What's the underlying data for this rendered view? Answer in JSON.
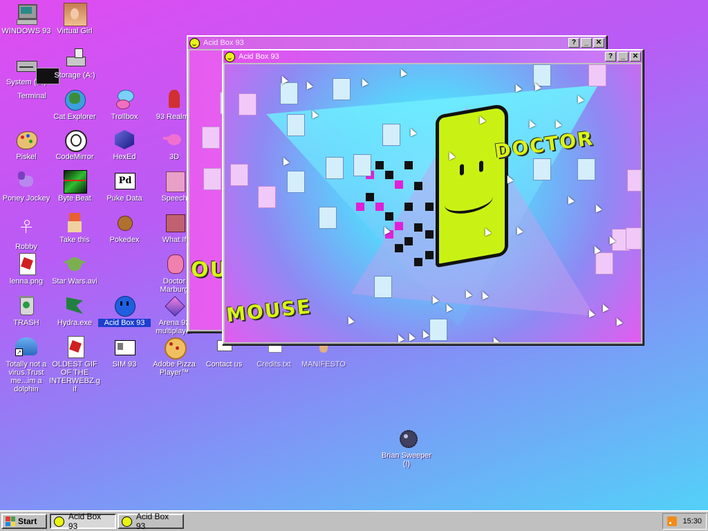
{
  "desktop": {
    "icons": [
      {
        "label": "WINDOWS 93",
        "icon": "computer-icon",
        "color": "#8c8c8c"
      },
      {
        "label": "Virtual Girl",
        "icon": "face-portrait-icon",
        "color": "#e0a070"
      },
      {
        "label": "System (C:)",
        "icon": "drive-icon",
        "color": "#a0a0a0"
      },
      {
        "label": "Storage (A:)",
        "icon": "floppy-drive-icon",
        "color": "#b0b0b0"
      },
      {
        "label": "Terminal",
        "icon": "terminal-icon",
        "color": "#111111"
      },
      {
        "label": "Cat Explorer",
        "icon": "globe-cat-icon",
        "color": "#3c8c3c"
      },
      {
        "label": "Trollbox",
        "icon": "chat-bubble-icon",
        "color": "#4ab0e8"
      },
      {
        "label": "93 Realms",
        "icon": "knight-icon",
        "color": "#d03030"
      },
      {
        "label": "Piskel",
        "icon": "palette-icon",
        "color": "#e0b050"
      },
      {
        "label": "CodeMirror",
        "icon": "codemirror-icon",
        "color": "#ffffff"
      },
      {
        "label": "HexEd",
        "icon": "hexagon-icon",
        "color": "#3030a0"
      },
      {
        "label": "3D",
        "icon": "teapot-icon",
        "color": "#f070d0"
      },
      {
        "label": "Poney Jockey",
        "icon": "pony-icon",
        "color": "#a070e0"
      },
      {
        "label": "Byte Beat",
        "icon": "byte-beat-icon",
        "color": "#104010"
      },
      {
        "label": "Puke Data",
        "icon": "pd-icon",
        "color": "#ffffff"
      },
      {
        "label": "Speech",
        "icon": "speech-face-icon",
        "color": "#e090c0"
      },
      {
        "label": "Robby",
        "icon": "stick-figure-icon",
        "color": "#ffffff"
      },
      {
        "label": "Take this",
        "icon": "pixel-character-icon",
        "color": "#e86030"
      },
      {
        "label": "Pokedex",
        "icon": "pokedex-icon",
        "color": "#b07030"
      },
      {
        "label": "What If",
        "icon": "book-icon",
        "color": "#c06070"
      },
      {
        "label": "lenna.png",
        "icon": "image-file-icon",
        "color": "#d02020"
      },
      {
        "label": "Star Wars.avi",
        "icon": "yoda-icon",
        "color": "#60a040"
      },
      {
        "label": "Doctor Marburg",
        "icon": "doctor-icon",
        "color": "#f070a0"
      },
      {
        "label": "TRASH",
        "icon": "trash-icon",
        "color": "#c0c0c0"
      },
      {
        "label": "Hydra.exe",
        "icon": "dragon-icon",
        "color": "#208040"
      },
      {
        "label": "Acid Box 93",
        "icon": "acid-smiley-icon",
        "color": "#2060e0"
      },
      {
        "label": "Arena 93 multiplayer",
        "icon": "cube-icon",
        "color": "#d040b0"
      },
      {
        "label": "Totally not a virus.Trust me...im a dolphin",
        "icon": "dolphin-icon",
        "color": "#4090e0"
      },
      {
        "label": "OLDEST GIF OF THE INTERWEBZ.gif",
        "icon": "gif-file-icon",
        "color": "#d02020"
      },
      {
        "label": "SIM 93",
        "icon": "sim-icon",
        "color": "#ffffff"
      },
      {
        "label": "Adobe Pizza Player™",
        "icon": "pizza-icon",
        "color": "#e0a040"
      },
      {
        "label": "Contact us",
        "icon": "pencil-icon",
        "color": "#ffffff"
      },
      {
        "label": "Credits.txt",
        "icon": "text-file-icon",
        "color": "#ffffff"
      },
      {
        "label": "MANIFESTO",
        "icon": "hand-icon",
        "color": "#e0b080"
      },
      {
        "label": "Brian Sweeper (!)",
        "icon": "mine-icon",
        "color": "#404060"
      }
    ]
  },
  "windows": [
    {
      "title": "Acid Box 93",
      "state": "inactive"
    },
    {
      "title": "Acid Box 93",
      "state": "active"
    }
  ],
  "titlebar_buttons": {
    "help": "?",
    "minimize": "_",
    "close": "✕"
  },
  "acid_art": {
    "word_top": "DOCTOR",
    "word_bottom": "MOUSE",
    "word_left_fragment": "OU"
  },
  "taskbar": {
    "start_label": "Start",
    "tasks": [
      {
        "label": "Acid Box 93",
        "pressed": true
      },
      {
        "label": "Acid Box 93",
        "pressed": false
      }
    ],
    "clock": "15:30"
  },
  "colors": {
    "desktop_top": "#e04cf0",
    "desktop_bottom": "#4fd6f8",
    "titlebar_active": "#e650f0",
    "selection": "#1c3fcf"
  }
}
